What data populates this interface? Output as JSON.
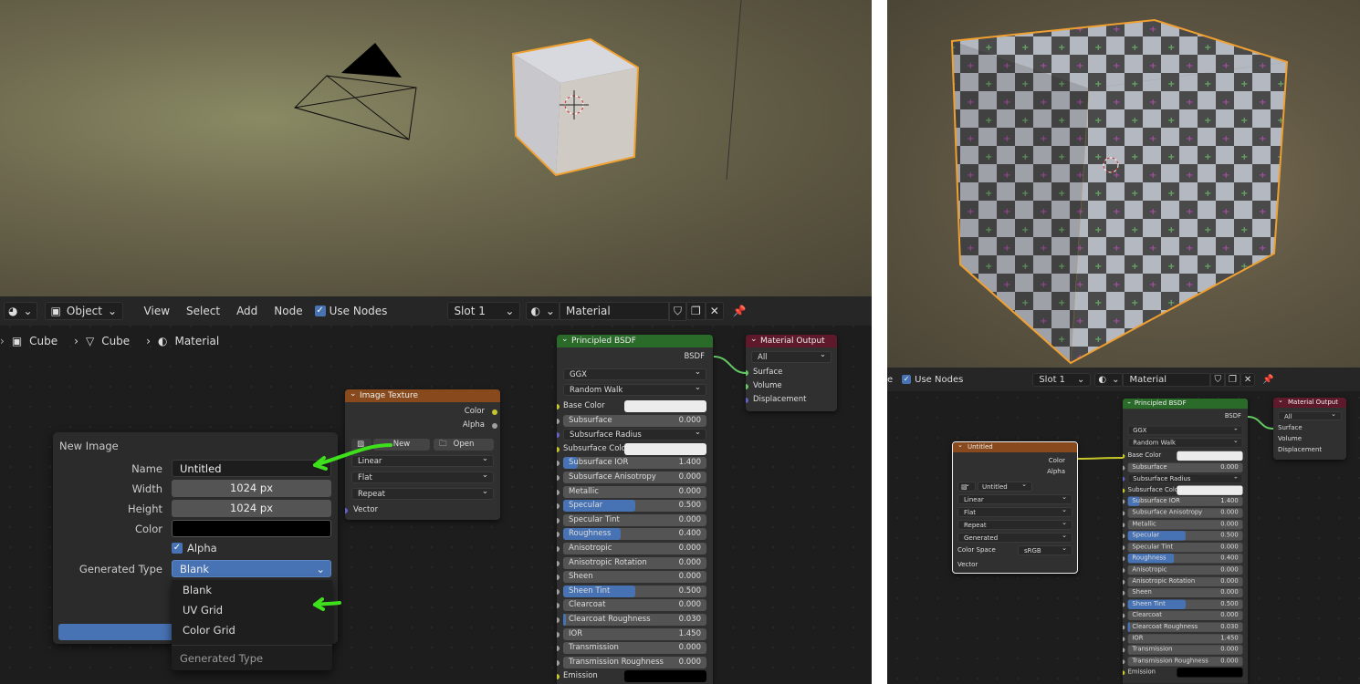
{
  "left": {
    "header": {
      "mode": "Object",
      "menus": [
        "View",
        "Select",
        "Add",
        "Node"
      ],
      "use_nodes": "Use Nodes",
      "slot": "Slot 1",
      "material": "Material"
    },
    "breadcrumb": [
      "Cube",
      "Cube",
      "Material"
    ],
    "image_texture": {
      "title": "Image Texture",
      "outputs": [
        "Color",
        "Alpha"
      ],
      "new_btn": "New",
      "open_btn": "Open",
      "interp": "Linear",
      "proj": "Flat",
      "ext": "Repeat",
      "input": "Vector"
    },
    "new_image": {
      "title": "New Image",
      "name_label": "Name",
      "name_value": "Untitled",
      "width_label": "Width",
      "width_value": "1024 px",
      "height_label": "Height",
      "height_value": "1024 px",
      "color_label": "Color",
      "alpha_label": "Alpha",
      "gentype_label": "Generated Type",
      "gentype_value": "Blank"
    },
    "gen_menu": {
      "items": [
        "Blank",
        "UV Grid",
        "Color Grid"
      ],
      "footer": "Generated Type"
    }
  },
  "bsdf": {
    "title": "Principled BSDF",
    "output": "BSDF",
    "dist": "GGX",
    "sss": "Random Walk",
    "rows": [
      {
        "label": "Base Color",
        "type": "color"
      },
      {
        "label": "Subsurface",
        "value": "0.000",
        "fill": 0
      },
      {
        "label": "Subsurface Radius",
        "type": "select"
      },
      {
        "label": "Subsurface Color",
        "type": "color"
      },
      {
        "label": "Subsurface IOR",
        "value": "1.400",
        "fill": 0.1
      },
      {
        "label": "Subsurface Anisotropy",
        "value": "0.000",
        "fill": 0
      },
      {
        "label": "Metallic",
        "value": "0.000",
        "fill": 0
      },
      {
        "label": "Specular",
        "value": "0.500",
        "fill": 0.5
      },
      {
        "label": "Specular Tint",
        "value": "0.000",
        "fill": 0
      },
      {
        "label": "Roughness",
        "value": "0.400",
        "fill": 0.4
      },
      {
        "label": "Anisotropic",
        "value": "0.000",
        "fill": 0
      },
      {
        "label": "Anisotropic Rotation",
        "value": "0.000",
        "fill": 0
      },
      {
        "label": "Sheen",
        "value": "0.000",
        "fill": 0
      },
      {
        "label": "Sheen Tint",
        "value": "0.500",
        "fill": 0.5
      },
      {
        "label": "Clearcoat",
        "value": "0.000",
        "fill": 0
      },
      {
        "label": "Clearcoat Roughness",
        "value": "0.030",
        "fill": 0.03
      },
      {
        "label": "IOR",
        "value": "1.450",
        "fill": 0
      },
      {
        "label": "Transmission",
        "value": "0.000",
        "fill": 0
      },
      {
        "label": "Transmission Roughness",
        "value": "0.000",
        "fill": 0
      },
      {
        "label": "Emission",
        "type": "black"
      }
    ]
  },
  "output_node": {
    "title": "Material Output",
    "target": "All",
    "inputs": [
      "Surface",
      "Volume",
      "Displacement"
    ]
  },
  "right": {
    "header": {
      "use_nodes": "Use Nodes",
      "slot": "Slot 1",
      "material": "Material"
    },
    "tex_node": {
      "title": "Untitled",
      "outputs": [
        "Color",
        "Alpha"
      ],
      "image_name": "Untitled",
      "interp": "Linear",
      "proj": "Flat",
      "ext": "Repeat",
      "source": "Generated",
      "cs_label": "Color Space",
      "cs_value": "sRGB",
      "input": "Vector"
    }
  },
  "colors": {
    "accent": "#4772b3",
    "selected_outline": "#f0a030",
    "arrow": "#3ee01c",
    "bsdf_header": "#2a6b2a",
    "output_header": "#5e1a2a",
    "texture_header": "#884a1c"
  }
}
